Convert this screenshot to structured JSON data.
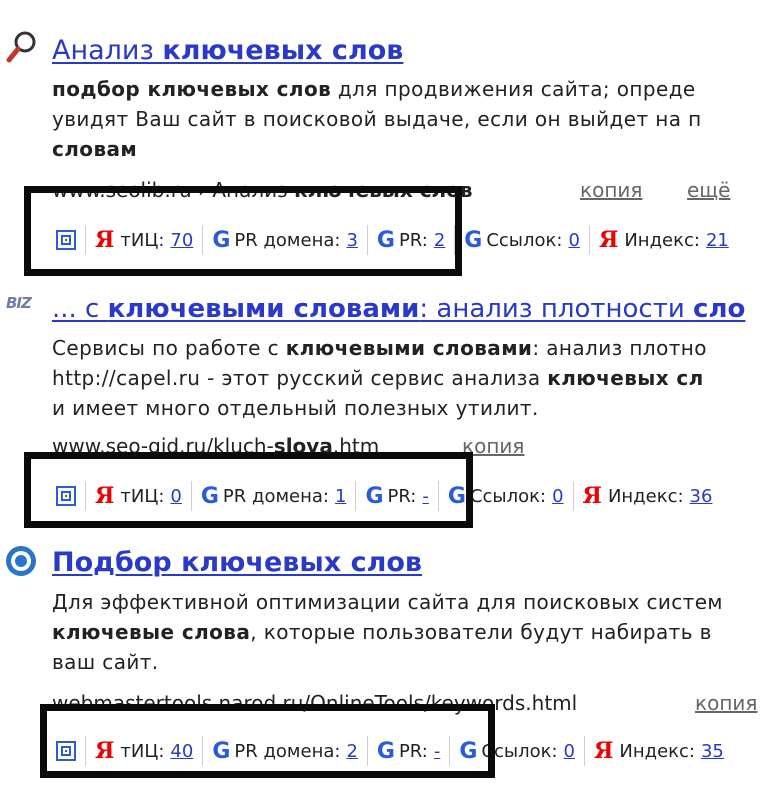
{
  "results": [
    {
      "title_plain": "Анализ ",
      "title_bold": "ключевых слов",
      "snippet": [
        [
          {
            "t": "подбор ключевых слов",
            "b": true
          },
          {
            "t": " для продвижения сайта; опреде",
            "b": false
          }
        ],
        [
          {
            "t": "увидят Ваш сайт в поисковой выдаче, если он выйдет на п",
            "b": false
          }
        ],
        [
          {
            "t": "словам",
            "b": true
          }
        ]
      ],
      "url_plain": "www.seolib.ru › Анализ ",
      "url_bold": "ключевых слов",
      "cache_label": "копия",
      "more_label": "ещё",
      "seo": {
        "tic_label": "тИЦ:",
        "tic": "70",
        "prdom_label": "PR домена:",
        "prdom": "3",
        "pr_label": "PR:",
        "pr": "2",
        "links_label": "Ссылок:",
        "links": "0",
        "index_label": "Индекс:",
        "index": "21"
      }
    },
    {
      "favicon_text": "BIZ",
      "title_plain": "... с ",
      "title_bold": "ключевыми словами",
      "title_rest": ": анализ плотности ",
      "title_bold2": "сло",
      "snippet": [
        [
          {
            "t": "Сервисы по работе с ",
            "b": false
          },
          {
            "t": "ключевыми словами",
            "b": true
          },
          {
            "t": ": анализ плотно",
            "b": false
          }
        ],
        [
          {
            "t": "http://capel.ru - этот русский сервис анализа ",
            "b": false
          },
          {
            "t": "ключевых сл",
            "b": true
          }
        ],
        [
          {
            "t": "и имеет много отдельный полезных утилит.",
            "b": false
          }
        ]
      ],
      "url_plain": "www.seo-gid.ru/kluch-",
      "url_bold": "slova",
      "url_rest": ".htm",
      "cache_label": "копия",
      "seo": {
        "tic_label": "тИЦ:",
        "tic": "0",
        "prdom_label": "PR домена:",
        "prdom": "1",
        "pr_label": "PR:",
        "pr": "-",
        "links_label": "Ссылок:",
        "links": "0",
        "index_label": "Индекс:",
        "index": "36"
      }
    },
    {
      "title_plain": "",
      "title_bold": "Подбор ключевых слов",
      "snippet": [
        [
          {
            "t": "Для эффективной оптимизации сайта для поисковых систем",
            "b": false
          }
        ],
        [
          {
            "t": "ключевые слова",
            "b": true
          },
          {
            "t": ", которые пользователи будут набирать в",
            "b": false
          }
        ],
        [
          {
            "t": "ваш сайт.",
            "b": false
          }
        ]
      ],
      "url_plain": "webmastertools.narod.ru/OnlineTools/keywords.html",
      "cache_label": "копия",
      "seo": {
        "tic_label": "тИЦ:",
        "tic": "40",
        "prdom_label": "PR домена:",
        "prdom": "2",
        "pr_label": "PR:",
        "pr": "-",
        "links_label": "Ссылок:",
        "links": "0",
        "index_label": "Индекс:",
        "index": "35"
      }
    }
  ],
  "seo_glyphs": {
    "yandex": "Я",
    "google": "G"
  },
  "icons": [
    "magnifier-icon",
    "biz-icon",
    "target-icon",
    "seo-spiral-icon",
    "yandex-icon",
    "google-icon"
  ],
  "colors": {
    "link": "#2a3ac8",
    "yandex": "#ee0000",
    "google": "#2a5cd9",
    "frame": "#0b0b0b"
  }
}
